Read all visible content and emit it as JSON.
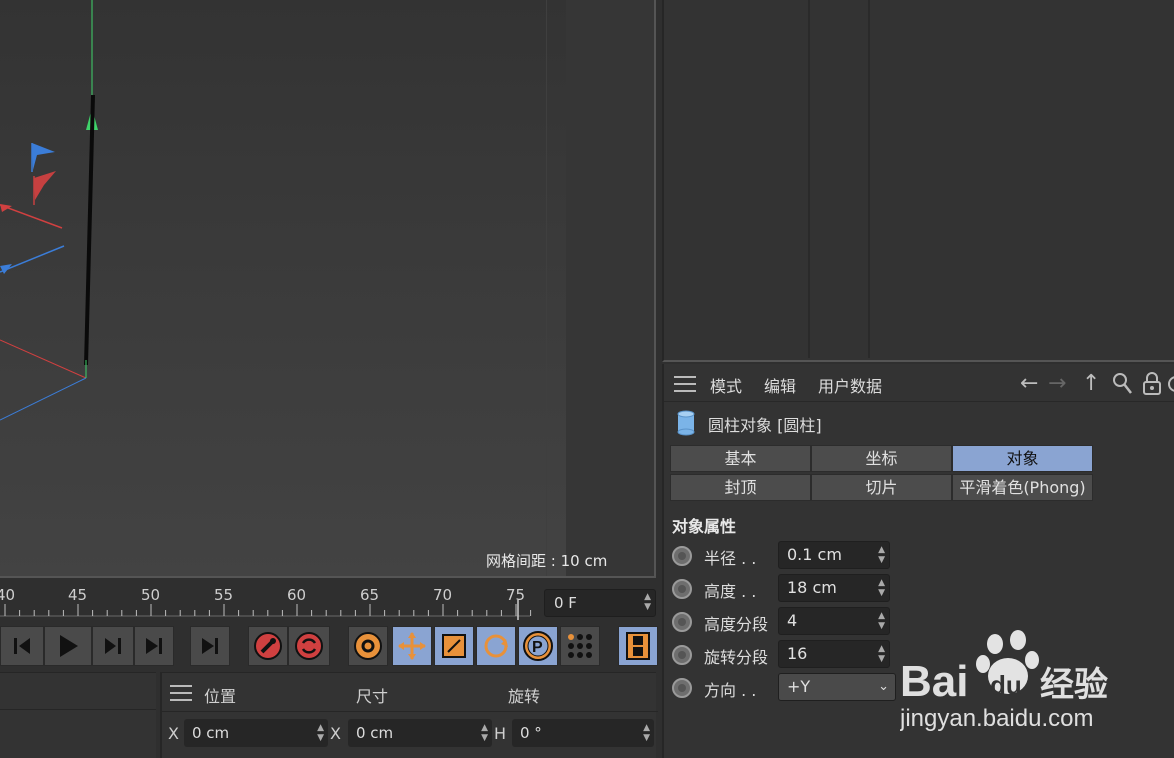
{
  "viewport": {
    "grid_label": "网格间距 : 10 cm"
  },
  "timeline": {
    "ticks": [
      "40",
      "45",
      "50",
      "55",
      "60",
      "65",
      "70",
      "75"
    ],
    "frame_value": "0 F"
  },
  "transport": {
    "buttons": [
      "go-start-icon",
      "prev-key-icon",
      "play-icon",
      "next-key-icon",
      "go-end-icon",
      "end-frame-icon",
      "record-icon",
      "autokey-icon",
      "keyframe-settings-icon",
      "move-key-icon",
      "scale-key-icon",
      "rotate-key-icon",
      "param-key-icon",
      "point-level-icon",
      "film-icon"
    ]
  },
  "coords": {
    "headers": [
      "位置",
      "尺寸",
      "旋转"
    ],
    "axes": [
      "X",
      "X",
      "H"
    ],
    "values": [
      "0 cm",
      "0 cm",
      "0 °"
    ]
  },
  "attr": {
    "menu": [
      "模式",
      "编辑",
      "用户数据"
    ],
    "object_title": "圆柱对象 [圆柱]",
    "tabs_row1": [
      "基本",
      "坐标",
      "对象"
    ],
    "tabs_row2": [
      "封顶",
      "切片",
      "平滑着色(Phong)"
    ],
    "active_tab": "对象",
    "section_title": "对象属性",
    "props": [
      {
        "label": "半径 . .",
        "value": "0.1 cm"
      },
      {
        "label": "高度 . .",
        "value": "18 cm"
      },
      {
        "label": "高度分段",
        "value": "4"
      },
      {
        "label": "旋转分段",
        "value": "16"
      },
      {
        "label": "方向 . .",
        "value": "+Y"
      }
    ]
  },
  "watermark": {
    "brand": "Bai",
    "brand_du": "du",
    "brand_cn": "经验",
    "url": "jingyan.baidu.com"
  },
  "colors": {
    "accent": "#8aa4d2",
    "axis_red": "#d04040",
    "axis_blue": "#3b7dd8",
    "axis_green": "#3fd36a",
    "orange": "#e8913a"
  }
}
